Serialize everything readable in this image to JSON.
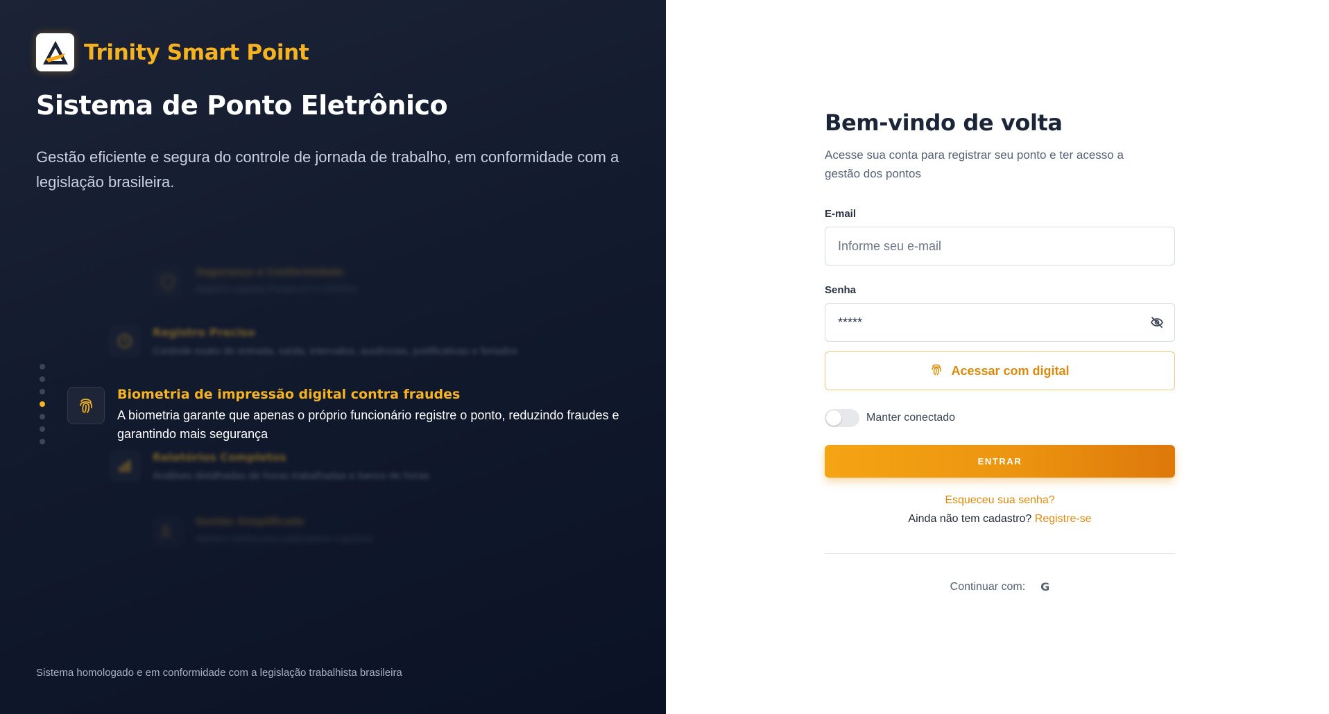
{
  "brand": {
    "name": "Trinity Smart Point"
  },
  "hero": {
    "title": "Sistema de Ponto Eletrônico",
    "description": "Gestão eficiente e segura do controle de jornada de trabalho, em conformidade com a legislação brasileira."
  },
  "features": [
    {
      "title": "Segurança e Conformidade",
      "description": "Registros seguindo Portaria 671 e 373/2011",
      "icon": "shield-icon"
    },
    {
      "title": "Registro Preciso",
      "description": "Controle exato de entrada, saída, intervalos, ausências, justificativas e feriados",
      "icon": "clock-icon"
    },
    {
      "title": "Biometria de impressão digital contra fraudes",
      "description": "A biometria garante que apenas o próprio funcionário registre o ponto, reduzindo fraudes e garantindo mais segurança",
      "icon": "fingerprint-icon"
    },
    {
      "title": "Relatórios Completos",
      "description": "Análises detalhadas de horas trabalhadas e banco de horas",
      "icon": "chart-icon"
    },
    {
      "title": "Gestão Simplificada",
      "description": "Interface intuitiva para colaboradores e gestores",
      "icon": "users-icon"
    }
  ],
  "carousel": {
    "active_index": 2,
    "total": 7
  },
  "footer_note": "Sistema homologado e em conformidade com a legislação trabalhista brasileira",
  "login": {
    "title": "Bem-vindo de volta",
    "subtitle": "Acesse sua conta para registrar seu ponto e ter acesso a gestão dos pontos",
    "email_label": "E-mail",
    "email_placeholder": "Informe seu e-mail",
    "password_label": "Senha",
    "password_value": "*****",
    "biometric_button": "Acessar com digital",
    "remember_label": "Manter conectado",
    "remember_checked": false,
    "submit_button": "ENTRAR",
    "forgot_link": "Esqueceu sua senha?",
    "register_prompt": "Ainda não tem cadastro?",
    "register_link": "Registre-se",
    "continue_with": "Continuar com:",
    "google_icon": "G"
  },
  "colors": {
    "accent": "#f5a414",
    "accent_dark": "#dd780a",
    "panel_dark": "#121a2e",
    "brand_yellow": "#f5b321"
  }
}
